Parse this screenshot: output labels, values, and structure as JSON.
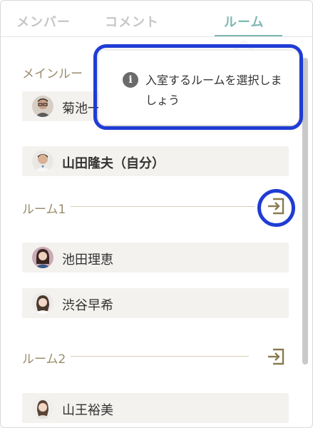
{
  "tabs": [
    {
      "label": "メンバー",
      "active": false
    },
    {
      "label": "コメント",
      "active": false
    },
    {
      "label": "ルーム",
      "active": true
    }
  ],
  "tooltip": {
    "icon": "info-icon",
    "icon_glyph": "i",
    "text": "入室するルームを選択しましょう"
  },
  "sections": [
    {
      "title": "メインルーム",
      "visible_title": "メインルー",
      "members": [
        {
          "name": "菊池一",
          "avatar": "avatar-man-glasses",
          "is_self": false
        },
        {
          "name": "山田隆夫（自分）",
          "avatar": "avatar-man-shirt",
          "is_self": true
        }
      ]
    },
    {
      "title": "ルーム1",
      "enter_icon": "enter-room-icon",
      "members": [
        {
          "name": "池田理恵",
          "avatar": "avatar-woman-1",
          "is_self": false
        },
        {
          "name": "渋谷早希",
          "avatar": "avatar-woman-2",
          "is_self": false
        }
      ]
    },
    {
      "title": "ルーム2",
      "enter_icon": "enter-room-icon",
      "members": [
        {
          "name": "山王裕美",
          "avatar": "avatar-woman-3",
          "is_self": false
        }
      ]
    }
  ],
  "colors": {
    "accent": "#7fb9b3",
    "section_label": "#9a8d6c",
    "member_bg": "#f4f2ef",
    "highlight": "#1f3cd4",
    "enter_icon": "#8a7a4e"
  }
}
